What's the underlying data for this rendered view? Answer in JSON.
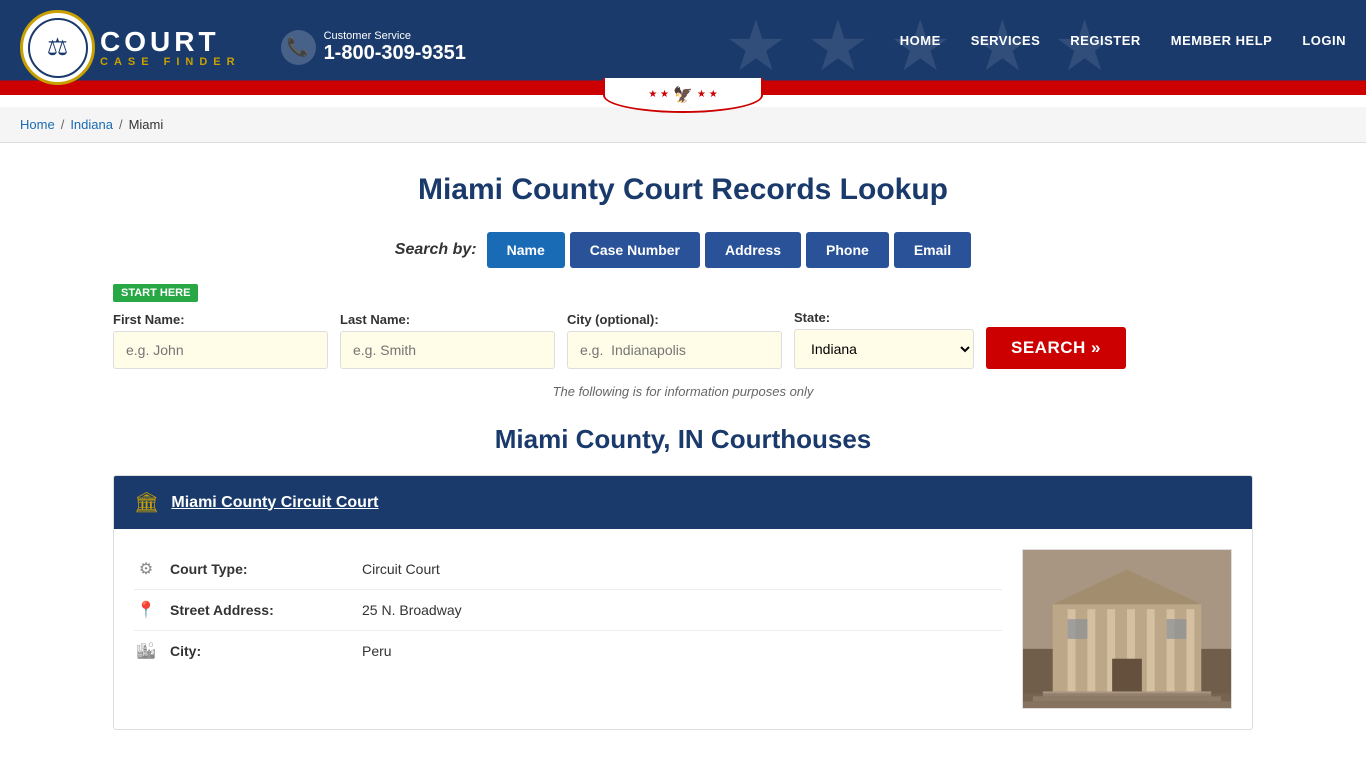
{
  "header": {
    "logo_court": "COURT",
    "logo_case_finder": "CASE FINDER",
    "customer_service_label": "Customer Service",
    "phone_number": "1-800-309-9351",
    "nav_items": [
      {
        "label": "HOME",
        "url": "#"
      },
      {
        "label": "SERVICES",
        "url": "#"
      },
      {
        "label": "REGISTER",
        "url": "#"
      },
      {
        "label": "MEMBER HELP",
        "url": "#"
      },
      {
        "label": "LOGIN",
        "url": "#"
      }
    ]
  },
  "breadcrumb": {
    "items": [
      {
        "label": "Home",
        "url": "#"
      },
      {
        "label": "Indiana",
        "url": "#"
      },
      {
        "label": "Miami",
        "url": null
      }
    ]
  },
  "main": {
    "page_title": "Miami County Court Records Lookup",
    "search_by_label": "Search by:",
    "search_tabs": [
      {
        "label": "Name",
        "active": true
      },
      {
        "label": "Case Number",
        "active": false
      },
      {
        "label": "Address",
        "active": false
      },
      {
        "label": "Phone",
        "active": false
      },
      {
        "label": "Email",
        "active": false
      }
    ],
    "start_here_badge": "START HERE",
    "form": {
      "first_name_label": "First Name:",
      "first_name_placeholder": "e.g. John",
      "last_name_label": "Last Name:",
      "last_name_placeholder": "e.g. Smith",
      "city_label": "City (optional):",
      "city_placeholder": "e.g.  Indianapolis",
      "state_label": "State:",
      "state_value": "Indiana",
      "search_button": "SEARCH »"
    },
    "info_note": "The following is for information purposes only",
    "courthouses_title": "Miami County, IN Courthouses",
    "courthouses": [
      {
        "name": "Miami County Circuit Court",
        "court_type": "Circuit Court",
        "street_address": "25 N. Broadway",
        "city": "Peru"
      }
    ]
  },
  "labels": {
    "court_type": "Court Type:",
    "street_address": "Street Address:",
    "city": "City:"
  }
}
